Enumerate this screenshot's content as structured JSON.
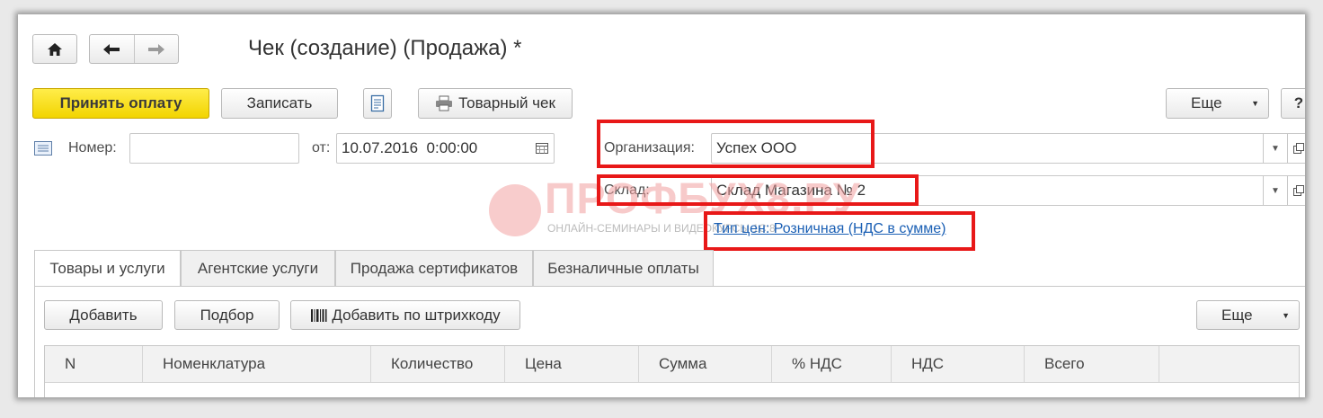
{
  "title": "Чек (создание) (Продажа) *",
  "toolbar": {
    "accept_payment": "Принять оплату",
    "save": "Записать",
    "receipt": "Товарный чек",
    "more": "Еще",
    "help": "?"
  },
  "form": {
    "number_label": "Номер:",
    "number_value": "",
    "date_label": "от:",
    "date_value": "10.07.2016  0:00:00",
    "org_label": "Организация:",
    "org_value": "Успех ООО",
    "warehouse_label": "Склад:",
    "warehouse_value": "Склад Магазина № 2",
    "price_type_link": "Тип цен: Розничная (НДС в сумме)"
  },
  "watermark": {
    "title": "ПРОФБУХ8.РУ",
    "subtitle": "ОНЛАЙН-СЕМИНАРЫ И ВИДЕОКУРСЫ 1С:8"
  },
  "tabs": [
    "Товары и услуги",
    "Агентские услуги",
    "Продажа сертификатов",
    "Безналичные оплаты"
  ],
  "table_toolbar": {
    "add": "Добавить",
    "pick": "Подбор",
    "add_barcode": "Добавить по штрихкоду",
    "more": "Еще"
  },
  "columns": [
    "N",
    "Номенклатура",
    "Количество",
    "Цена",
    "Сумма",
    "% НДС",
    "НДС",
    "Всего"
  ],
  "colors": {
    "accent": "#f2d400",
    "highlight": "#e81818",
    "link": "#1a5fb4"
  }
}
